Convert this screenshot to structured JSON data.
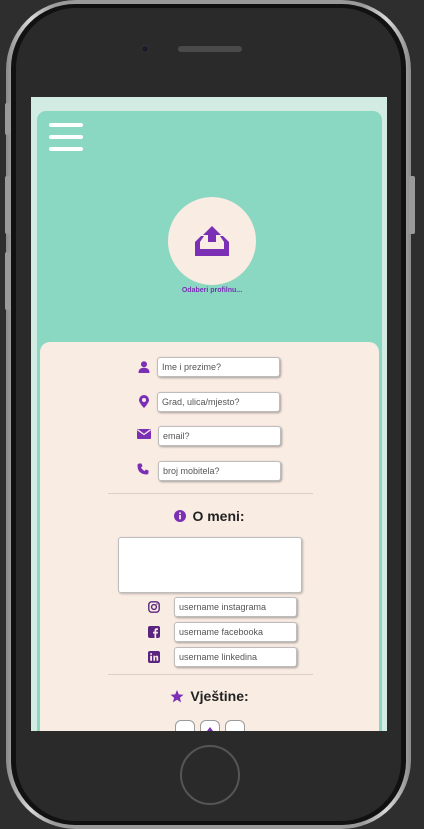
{
  "device": {
    "camera": "camera-icon",
    "speaker": "speaker-grille",
    "home": "home-button"
  },
  "colors": {
    "accent": "#7b2fb5",
    "hero": "#8ad8c2",
    "card": "#f9ece3",
    "screen_bg": "#d3ece3"
  },
  "header": {
    "menu_icon": "hamburger-menu-icon"
  },
  "profile": {
    "upload_icon": "upload-tray-icon",
    "label": "Odaberi profilnu..."
  },
  "contact": {
    "name_placeholder": "Ime i prezime?",
    "address_placeholder": "Grad, ulica/mjesto?",
    "email_placeholder": "email?",
    "phone_placeholder": "broj mobitela?"
  },
  "about": {
    "title": "O meni:",
    "icon": "info-circle-icon",
    "text": ""
  },
  "social": {
    "instagram_placeholder": "username instagrama",
    "facebook_placeholder": "username facebooka",
    "linkedin_placeholder": "username linkedina"
  },
  "skills": {
    "title": "Vještine:",
    "icon": "star-icon"
  }
}
